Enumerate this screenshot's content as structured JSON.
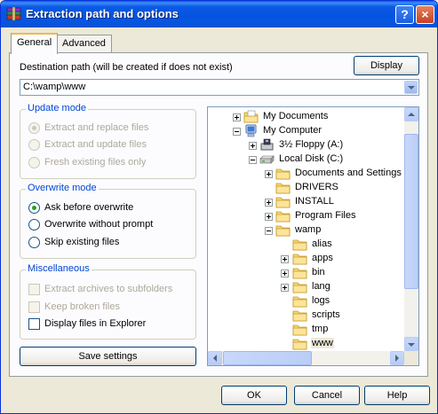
{
  "window": {
    "title": "Extraction path and options"
  },
  "title_buttons": {
    "help": "?",
    "close": "×"
  },
  "tabs": [
    {
      "label": "General",
      "active": true
    },
    {
      "label": "Advanced",
      "active": false
    }
  ],
  "destination": {
    "label": "Destination path (will be created if does not exist)",
    "value": "C:\\wamp\\www",
    "display_button": "Display"
  },
  "update_mode": {
    "title": "Update mode",
    "enabled": false,
    "options": [
      {
        "label": "Extract and replace files",
        "selected": true
      },
      {
        "label": "Extract and update files",
        "selected": false
      },
      {
        "label": "Fresh existing files only",
        "selected": false
      }
    ]
  },
  "overwrite_mode": {
    "title": "Overwrite mode",
    "enabled": true,
    "options": [
      {
        "label": "Ask before overwrite",
        "selected": true
      },
      {
        "label": "Overwrite without prompt",
        "selected": false
      },
      {
        "label": "Skip existing files",
        "selected": false
      }
    ]
  },
  "miscellaneous": {
    "title": "Miscellaneous",
    "options": [
      {
        "label": "Extract archives to subfolders",
        "checked": false,
        "enabled": false
      },
      {
        "label": "Keep broken files",
        "checked": false,
        "enabled": false
      },
      {
        "label": "Display files in Explorer",
        "checked": false,
        "enabled": true
      }
    ]
  },
  "save_button": "Save settings",
  "tree": [
    {
      "label": "My Documents",
      "level": 0,
      "expander": "plus",
      "icon": "my-documents-icon"
    },
    {
      "label": "My Computer",
      "level": 0,
      "expander": "minus",
      "icon": "my-computer-icon"
    },
    {
      "label": "3½ Floppy (A:)",
      "level": 1,
      "expander": "plus",
      "icon": "floppy-drive-icon"
    },
    {
      "label": "Local Disk (C:)",
      "level": 1,
      "expander": "minus",
      "icon": "hard-drive-icon"
    },
    {
      "label": "Documents and Settings",
      "level": 2,
      "expander": "plus",
      "icon": "folder-icon"
    },
    {
      "label": "DRIVERS",
      "level": 2,
      "expander": "none",
      "icon": "folder-icon"
    },
    {
      "label": "INSTALL",
      "level": 2,
      "expander": "plus",
      "icon": "folder-icon"
    },
    {
      "label": "Program Files",
      "level": 2,
      "expander": "plus",
      "icon": "folder-icon"
    },
    {
      "label": "wamp",
      "level": 2,
      "expander": "minus",
      "icon": "folder-icon"
    },
    {
      "label": "alias",
      "level": 3,
      "expander": "none",
      "icon": "folder-icon"
    },
    {
      "label": "apps",
      "level": 3,
      "expander": "plus",
      "icon": "folder-icon"
    },
    {
      "label": "bin",
      "level": 3,
      "expander": "plus",
      "icon": "folder-icon"
    },
    {
      "label": "lang",
      "level": 3,
      "expander": "plus",
      "icon": "folder-icon"
    },
    {
      "label": "logs",
      "level": 3,
      "expander": "none",
      "icon": "folder-icon"
    },
    {
      "label": "scripts",
      "level": 3,
      "expander": "none",
      "icon": "folder-icon"
    },
    {
      "label": "tmp",
      "level": 3,
      "expander": "none",
      "icon": "folder-icon"
    },
    {
      "label": "www",
      "level": 3,
      "expander": "none",
      "icon": "folder-icon",
      "selected": true
    }
  ],
  "footer": {
    "ok": "OK",
    "cancel": "Cancel",
    "help": "Help"
  },
  "colors": {
    "titlebar": "#0554E0",
    "group_title": "#0046D5",
    "folder": "#F7D774"
  }
}
